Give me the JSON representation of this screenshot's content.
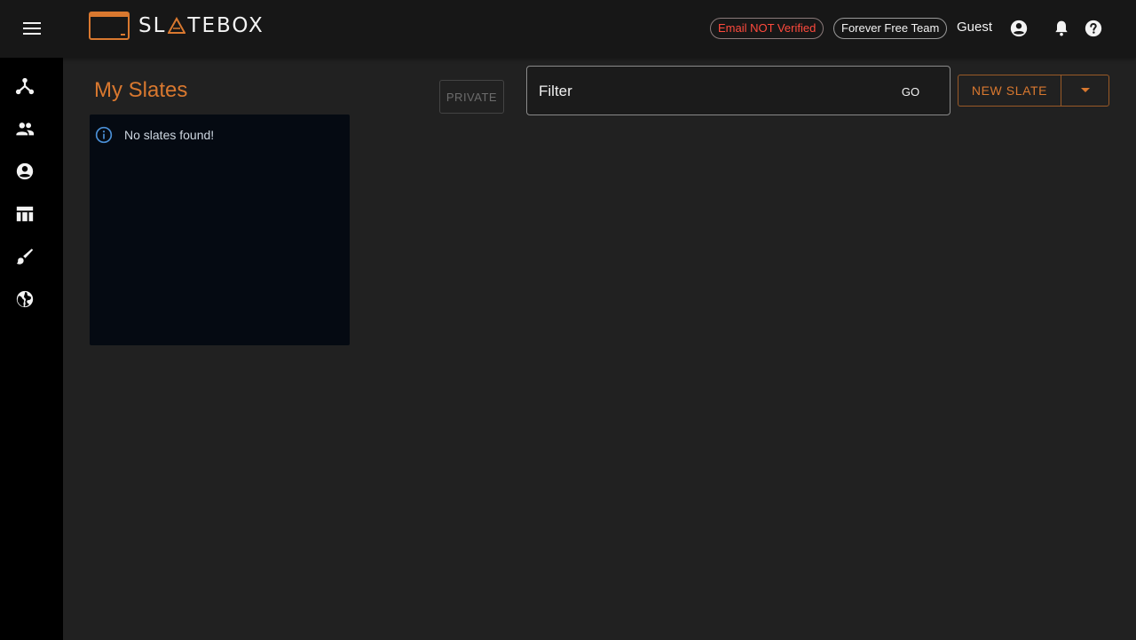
{
  "header": {
    "menu_icon": "hamburger-menu-icon",
    "brand": {
      "left_text": "SL",
      "right_text": "TEBOX",
      "accent_color": "#d9782f"
    },
    "email_status": "Email NOT Verified",
    "team": "Forever Free Team",
    "user": "Guest",
    "icons": [
      "account-circle-icon",
      "bell-icon",
      "help-icon"
    ]
  },
  "sidebar": {
    "items": [
      {
        "icon": "hub-network-icon"
      },
      {
        "icon": "people-icon"
      },
      {
        "icon": "account-circle-icon"
      },
      {
        "icon": "table-icon"
      },
      {
        "icon": "paintbrush-icon"
      },
      {
        "icon": "globe-icon"
      }
    ]
  },
  "main": {
    "title": "My Slates",
    "private_label": "PRIVATE",
    "filter": {
      "placeholder": "Filter",
      "value": ""
    },
    "go_label": "GO",
    "new_slate_label": "NEW SLATE",
    "empty_message": "No slates found!",
    "info_icon": "info-icon"
  },
  "colors": {
    "accent": "#d9782f",
    "error": "#ff4a3d",
    "background": "#212121",
    "sidebar": "#000000",
    "topbar": "#171717",
    "panel": "#050a12",
    "info": "#4a8fd6"
  }
}
